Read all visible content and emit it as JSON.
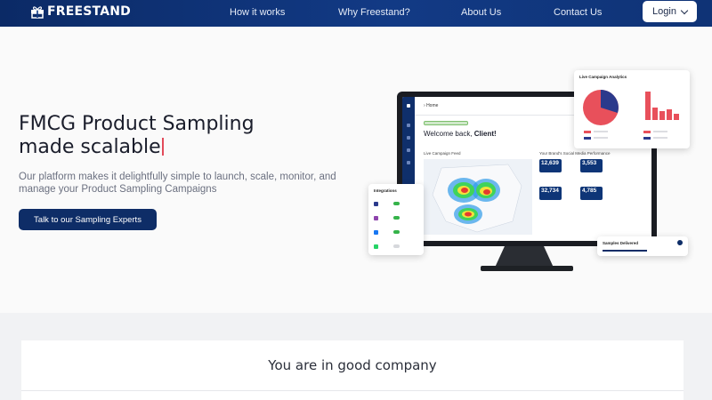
{
  "nav": {
    "brand": "FREESTAND",
    "links": [
      "How it works",
      "Why Freestand?",
      "About Us",
      "Contact Us"
    ],
    "login_label": "Login"
  },
  "hero": {
    "headline_line1": "FMCG Product Sampling",
    "headline_line2": "made scalable",
    "subtext": "Our platform makes it delightfully simple to launch, scale, monitor, and manage your Product Sampling Campaigns",
    "cta_label": "Talk to our Sampling Experts"
  },
  "dashboard": {
    "home_label": "Home",
    "welcome_prefix": "Welcome back, ",
    "welcome_name": "Client!",
    "live_feed_label": "Live Campaign Feed",
    "social_label": "Your Brand's Social Media Performance",
    "tiles": [
      "12,639",
      "3,553",
      "32,734",
      "4,785"
    ],
    "analytics_title": "Live Campaign Analytics",
    "integrations_title": "Integrations",
    "samples_title": "Samples Delivered"
  },
  "company": {
    "title": "You are in good company"
  },
  "colors": {
    "nav": "#0f3376",
    "cta": "#0e2d67",
    "caret": "#e24a5a",
    "pie_red": "#e8505b",
    "pie_navy": "#2b3a8c"
  }
}
